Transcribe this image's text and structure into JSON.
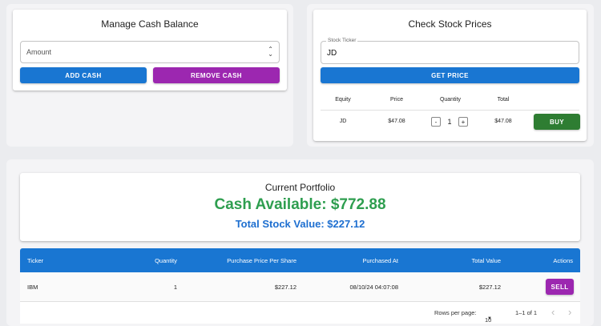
{
  "cash_card": {
    "title": "Manage Cash Balance",
    "amount_placeholder": "Amount",
    "add_label": "ADD CASH",
    "remove_label": "REMOVE CASH"
  },
  "stock_card": {
    "title": "Check Stock Prices",
    "ticker_legend": "Stock Ticker",
    "ticker_value": "JD",
    "get_price_label": "GET PRICE",
    "headers": [
      "Equity",
      "Price",
      "Quantity",
      "Total"
    ],
    "row": {
      "equity": "JD",
      "price": "$47.08",
      "quantity": "1",
      "total": "$47.08"
    },
    "minus": "-",
    "plus": "+",
    "buy_label": "BUY"
  },
  "portfolio": {
    "title": "Current Portfolio",
    "cash_available": "Cash Available: $772.88",
    "stock_value": "Total Stock Value: $227.12",
    "columns": [
      "Ticker",
      "Quantity",
      "Purchase Price Per Share",
      "Purchased At",
      "Total Value",
      "Actions"
    ],
    "rows": [
      {
        "ticker": "IBM",
        "quantity": "1",
        "price": "$227.12",
        "purchased_at": "08/10/24 04:07:08",
        "total": "$227.12",
        "action": "SELL"
      }
    ],
    "pagination": {
      "rows_per_page_label": "Rows per page:",
      "rows_per_page_value": "10",
      "range": "1–1 of 1",
      "prev": "‹",
      "next": "›"
    }
  },
  "colors": {
    "primary": "#1976d2",
    "secondary": "#9c27b0",
    "success": "#2e7d32",
    "cash_text": "#2e9e4f",
    "stock_text": "#1e6fd0"
  }
}
